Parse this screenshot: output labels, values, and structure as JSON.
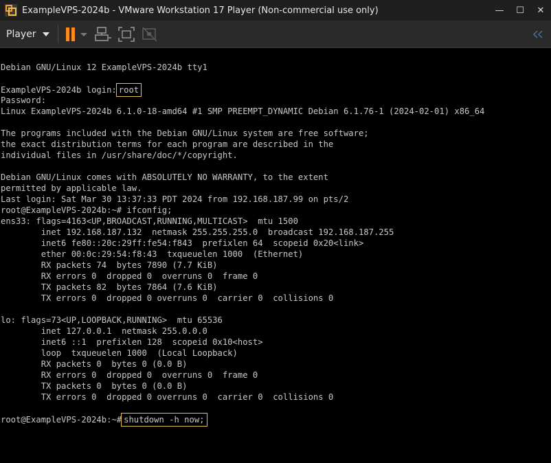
{
  "window": {
    "title": "ExampleVPS-2024b - VMware Workstation 17 Player (Non-commercial use only)",
    "controls": {
      "minimize": "—",
      "maximize": "☐",
      "close": "✕"
    }
  },
  "toolbar": {
    "player_label": "Player",
    "icons": [
      "pause-icon",
      "send-ctrl-alt-del-icon",
      "fullscreen-icon",
      "unity-icon",
      "collapse-toolbar-icon"
    ],
    "accent": "#ff8a1f"
  },
  "terminal": {
    "text_color": "#c8c8c8",
    "highlight_color": "#e3c04a",
    "l": [
      "Debian GNU/Linux 12 ExampleVPS-2024b tty1",
      "",
      "ExampleVPS-2024b login:",
      "Password:",
      "Linux ExampleVPS-2024b 6.1.0-18-amd64 #1 SMP PREEMPT_DYNAMIC Debian 6.1.76-1 (2024-02-01) x86_64",
      "",
      "The programs included with the Debian GNU/Linux system are free software;",
      "the exact distribution terms for each program are described in the",
      "individual files in /usr/share/doc/*/copyright.",
      "",
      "Debian GNU/Linux comes with ABSOLUTELY NO WARRANTY, to the extent",
      "permitted by applicable law.",
      "Last login: Sat Mar 30 13:37:33 PDT 2024 from 192.168.187.99 on pts/2",
      "root@ExampleVPS-2024b:~# ifconfig;",
      "ens33: flags=4163<UP,BROADCAST,RUNNING,MULTICAST>  mtu 1500",
      "        inet 192.168.187.132  netmask 255.255.255.0  broadcast 192.168.187.255",
      "        inet6 fe80::20c:29ff:fe54:f843  prefixlen 64  scopeid 0x20<link>",
      "        ether 00:0c:29:54:f8:43  txqueuelen 1000  (Ethernet)",
      "        RX packets 74  bytes 7890 (7.7 KiB)",
      "        RX errors 0  dropped 0  overruns 0  frame 0",
      "        TX packets 82  bytes 7864 (7.6 KiB)",
      "        TX errors 0  dropped 0 overruns 0  carrier 0  collisions 0",
      "",
      "lo: flags=73<UP,LOOPBACK,RUNNING>  mtu 65536",
      "        inet 127.0.0.1  netmask 255.0.0.0",
      "        inet6 ::1  prefixlen 128  scopeid 0x10<host>",
      "        loop  txqueuelen 1000  (Local Loopback)",
      "        RX packets 0  bytes 0 (0.0 B)",
      "        RX errors 0  dropped 0  overruns 0  frame 0",
      "        TX packets 0  bytes 0 (0.0 B)",
      "        TX errors 0  dropped 0 overruns 0  carrier 0  collisions 0",
      "",
      "root@ExampleVPS-2024b:~#"
    ],
    "login_input": "root",
    "command_input": "shutdown -h now;"
  }
}
